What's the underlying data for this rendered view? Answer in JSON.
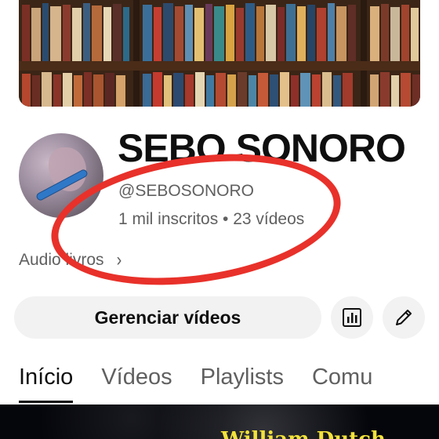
{
  "channel": {
    "name": "SEBO SONORO",
    "handle": "@SEBOSONORO",
    "stats": "1 mil inscritos • 23 vídeos",
    "about": "Audio livros",
    "about_chevron": "›"
  },
  "actions": {
    "manage_label": "Gerenciar vídeos",
    "analytics_icon": "analytics-icon",
    "edit_icon": "pencil-icon"
  },
  "tabs": [
    {
      "label": "Início",
      "active": true
    },
    {
      "label": "Vídeos",
      "active": false
    },
    {
      "label": "Playlists",
      "active": false
    },
    {
      "label": "Comu",
      "active": false
    }
  ],
  "video_preview": {
    "title_fragment": "William Dutch..."
  },
  "colors": {
    "annotation": "#e8312a",
    "button_bg": "#f2f2f2",
    "secondary_text": "#606060",
    "video_title": "#f2e23a"
  }
}
